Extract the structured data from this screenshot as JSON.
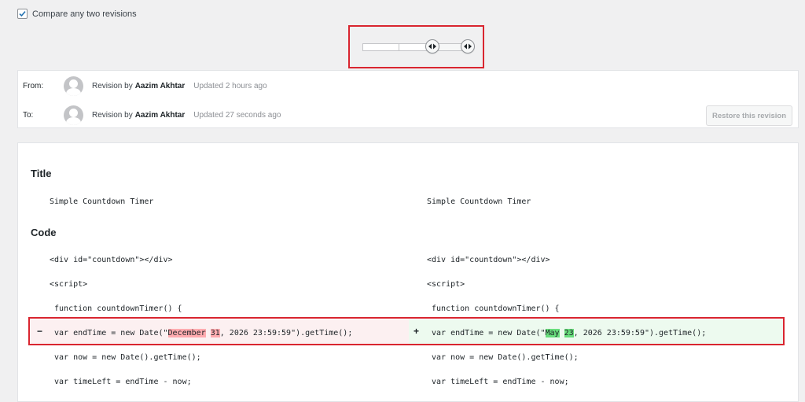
{
  "compare": {
    "label": "Compare any two revisions",
    "checked": true
  },
  "slider": {
    "from_handle_icon": "arrows-left-right-icon",
    "to_handle_icon": "arrows-left-right-icon"
  },
  "from": {
    "label": "From:",
    "revision_by": "Revision by",
    "author": "Aazim Akhtar",
    "updated": "Updated 2 hours ago"
  },
  "to": {
    "label": "To:",
    "revision_by": "Revision by",
    "author": "Aazim Akhtar",
    "updated": "Updated 27 seconds ago"
  },
  "restore_button": "Restore this revision",
  "diff": {
    "title_heading": "Title",
    "title_left": "Simple Countdown Timer",
    "title_right": "Simple Countdown Timer",
    "code_heading": "Code",
    "lines": [
      {
        "left": "<div id=\"countdown\"></div>",
        "right": "<div id=\"countdown\"></div>"
      },
      {
        "left": "<script>",
        "right": "<script>"
      },
      {
        "left": " function countdownTimer() {",
        "right": " function countdownTimer() {"
      }
    ],
    "changed": {
      "minus": "−",
      "plus": "+",
      "left_pre": " var endTime = new Date(\"",
      "left_del1": "December",
      "left_mid1": " ",
      "left_del2": "31",
      "left_post": ", 2026 23:59:59\").getTime();",
      "right_pre": " var endTime = new Date(\"",
      "right_ins1": "May",
      "right_mid1": " ",
      "right_ins2": "23",
      "right_post": ", 2026 23:59:59\").getTime();"
    },
    "after_lines": [
      {
        "left": " var now = new Date().getTime();",
        "right": " var now = new Date().getTime();"
      },
      {
        "left": " var timeLeft = endTime - now;",
        "right": " var timeLeft = endTime - now;"
      }
    ]
  },
  "colors": {
    "deleted_bg": "#fcf0f1",
    "deleted_mark": "#ffabaf",
    "inserted_bg": "#edfaef",
    "inserted_mark": "#68de7c",
    "highlight": "#d9252f"
  }
}
